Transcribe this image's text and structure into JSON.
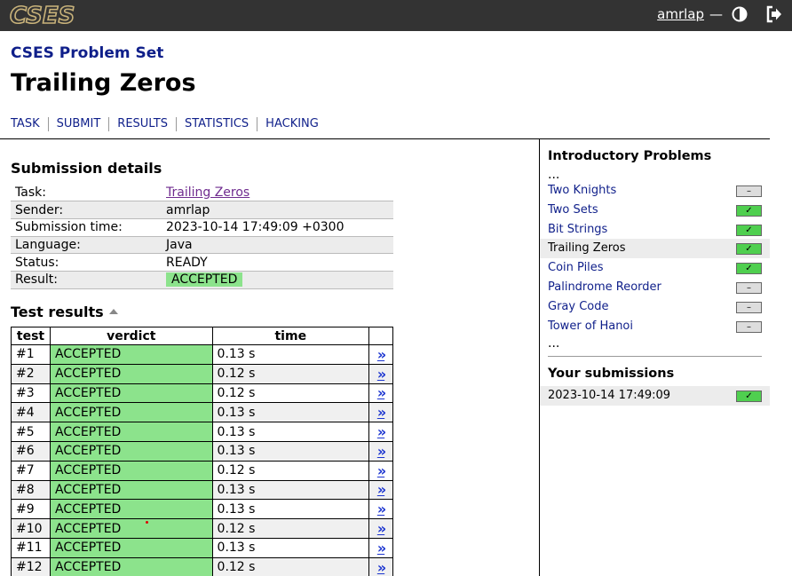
{
  "header": {
    "logo_text": "CSES",
    "username": "amrlap",
    "separator": "—",
    "icons": {
      "theme": "contrast-icon",
      "logout": "logout-icon"
    }
  },
  "page": {
    "subtitle": "CSES Problem Set",
    "title": "Trailing Zeros"
  },
  "tabs": [
    "TASK",
    "SUBMIT",
    "RESULTS",
    "STATISTICS",
    "HACKING"
  ],
  "submission": {
    "heading": "Submission details",
    "rows": [
      {
        "label": "Task:",
        "value": "Trailing Zeros"
      },
      {
        "label": "Sender:",
        "value": "amrlap"
      },
      {
        "label": "Submission time:",
        "value": "2023-10-14 17:49:09 +0300"
      },
      {
        "label": "Language:",
        "value": "Java"
      },
      {
        "label": "Status:",
        "value": "READY"
      },
      {
        "label": "Result:",
        "value": "ACCEPTED"
      }
    ]
  },
  "tests": {
    "heading": "Test results",
    "columns": [
      "test",
      "verdict",
      "time"
    ],
    "link_glyph": "»",
    "rows": [
      {
        "test": "#1",
        "verdict": "ACCEPTED",
        "time": "0.13 s"
      },
      {
        "test": "#2",
        "verdict": "ACCEPTED",
        "time": "0.12 s"
      },
      {
        "test": "#3",
        "verdict": "ACCEPTED",
        "time": "0.12 s"
      },
      {
        "test": "#4",
        "verdict": "ACCEPTED",
        "time": "0.13 s"
      },
      {
        "test": "#5",
        "verdict": "ACCEPTED",
        "time": "0.13 s"
      },
      {
        "test": "#6",
        "verdict": "ACCEPTED",
        "time": "0.13 s"
      },
      {
        "test": "#7",
        "verdict": "ACCEPTED",
        "time": "0.12 s"
      },
      {
        "test": "#8",
        "verdict": "ACCEPTED",
        "time": "0.13 s"
      },
      {
        "test": "#9",
        "verdict": "ACCEPTED",
        "time": "0.13 s"
      },
      {
        "test": "#10",
        "verdict": "ACCEPTED",
        "time": "0.12 s"
      },
      {
        "test": "#11",
        "verdict": "ACCEPTED",
        "time": "0.13 s"
      },
      {
        "test": "#12",
        "verdict": "ACCEPTED",
        "time": "0.12 s"
      }
    ]
  },
  "sidebar": {
    "heading": "Introductory Problems",
    "ellipsis": "...",
    "items": [
      {
        "label": "Two Knights",
        "mark": "–",
        "solved": false
      },
      {
        "label": "Two Sets",
        "mark": "✓",
        "solved": true
      },
      {
        "label": "Bit Strings",
        "mark": "✓",
        "solved": true
      },
      {
        "label": "Trailing Zeros",
        "mark": "✓",
        "solved": true,
        "current": true
      },
      {
        "label": "Coin Piles",
        "mark": "✓",
        "solved": true
      },
      {
        "label": "Palindrome Reorder",
        "mark": "–",
        "solved": false
      },
      {
        "label": "Gray Code",
        "mark": "–",
        "solved": false
      },
      {
        "label": "Tower of Hanoi",
        "mark": "–",
        "solved": false
      }
    ],
    "submissions_heading": "Your submissions",
    "submissions": [
      {
        "time": "2023-10-14 17:49:09",
        "mark": "✓"
      }
    ]
  },
  "colors": {
    "topbar": "#333333",
    "accepted": "#8ce38c",
    "solved_mark": "#4fcf4f",
    "link": "#0f1f8a"
  }
}
